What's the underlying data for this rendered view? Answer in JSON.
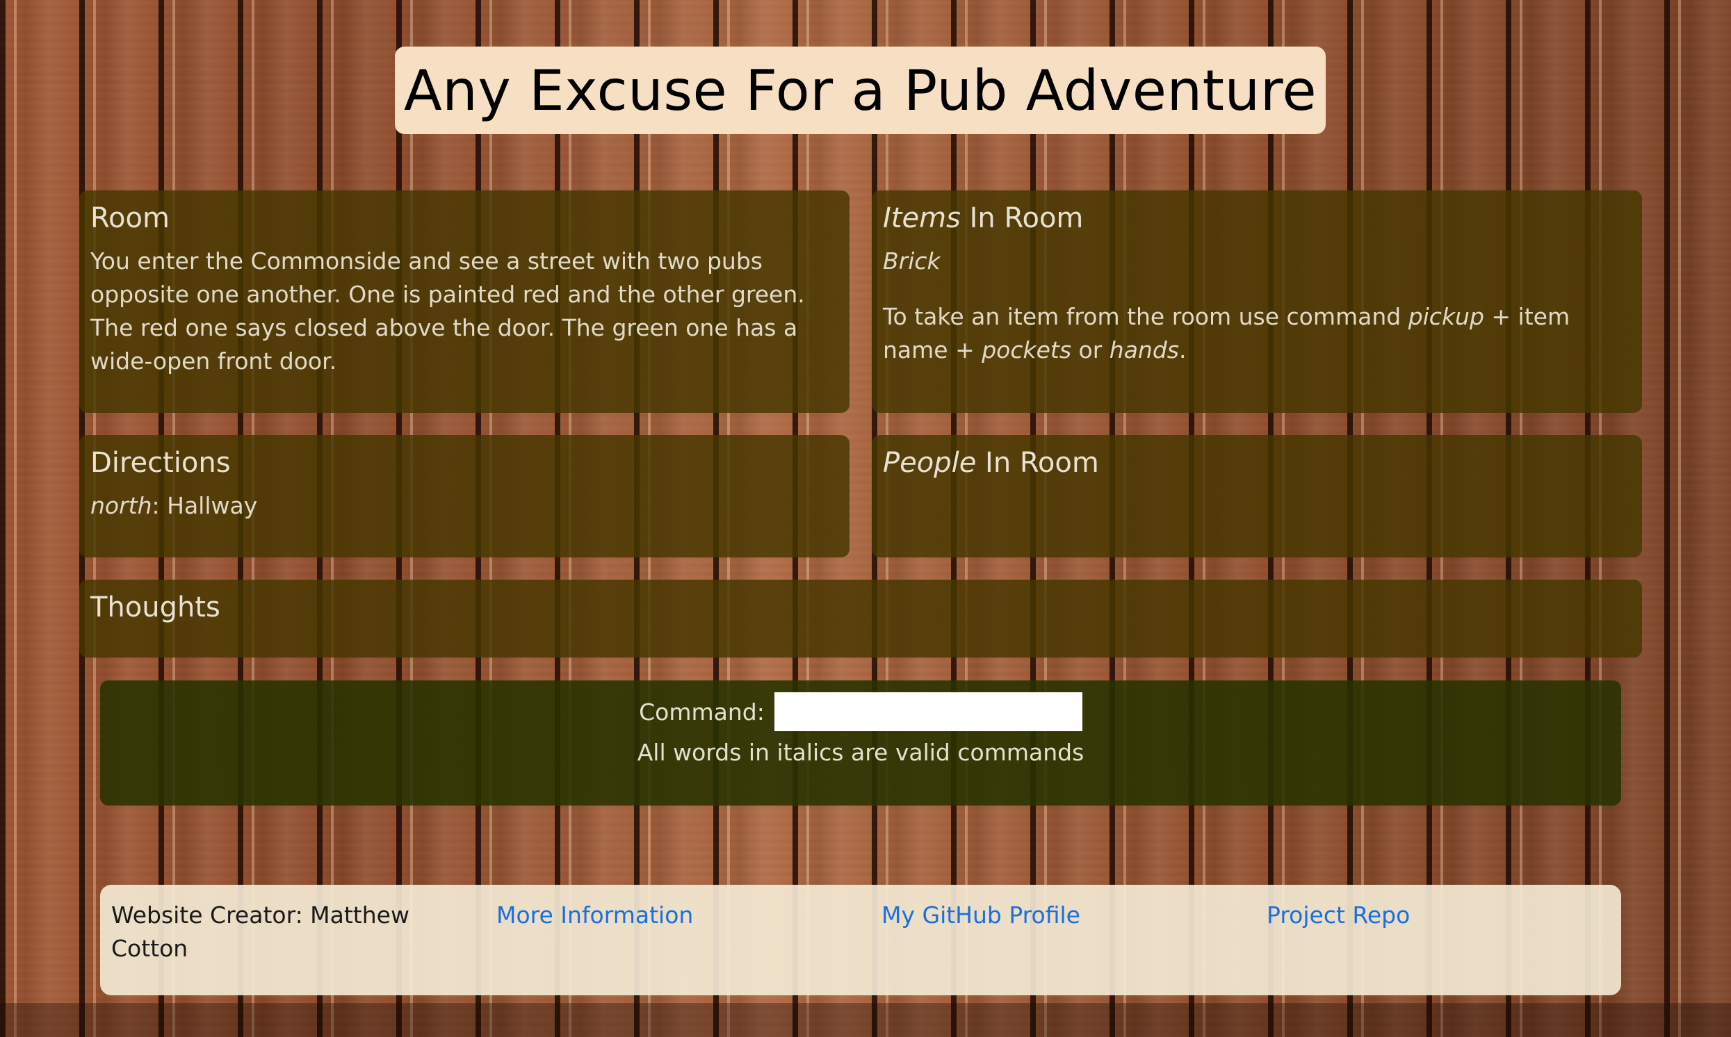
{
  "header": {
    "title": "Any Excuse For a Pub Adventure"
  },
  "room": {
    "heading": "Room",
    "description": "You enter the Commonside and see a street with two pubs opposite one another. One is painted red and the other green. The red one says closed above the door. The green one has a wide-open front door."
  },
  "items_in_room": {
    "heading_em": "Items",
    "heading_rest": " In Room",
    "items": [
      "Brick"
    ],
    "instruction": {
      "part1": "To take an item from the room use command ",
      "cmd_pickup": "pickup",
      "part2": " + item name + ",
      "cmd_pockets": "pockets",
      "part3": " or ",
      "cmd_hands": "hands",
      "part4": "."
    }
  },
  "directions": {
    "heading": "Directions",
    "entries": [
      {
        "direction": "north",
        "separator": ": ",
        "destination": "Hallway"
      }
    ]
  },
  "people_in_room": {
    "heading_em": "People",
    "heading_rest": " In Room"
  },
  "thoughts": {
    "heading": "Thoughts"
  },
  "command": {
    "label": "Command:",
    "value": "",
    "placeholder": "",
    "hint": "All words in italics are valid commands"
  },
  "footer": {
    "creator": "Website Creator: Matthew Cotton",
    "links": {
      "more_info": "More Information",
      "github": "My GitHub Profile",
      "repo": "Project Repo"
    }
  },
  "colors": {
    "title_bg": "#f7dfc4",
    "panel_bg": "#463700",
    "command_bg": "#283200",
    "footer_bg": "#f5ecd6",
    "link": "#1a6fe0"
  }
}
